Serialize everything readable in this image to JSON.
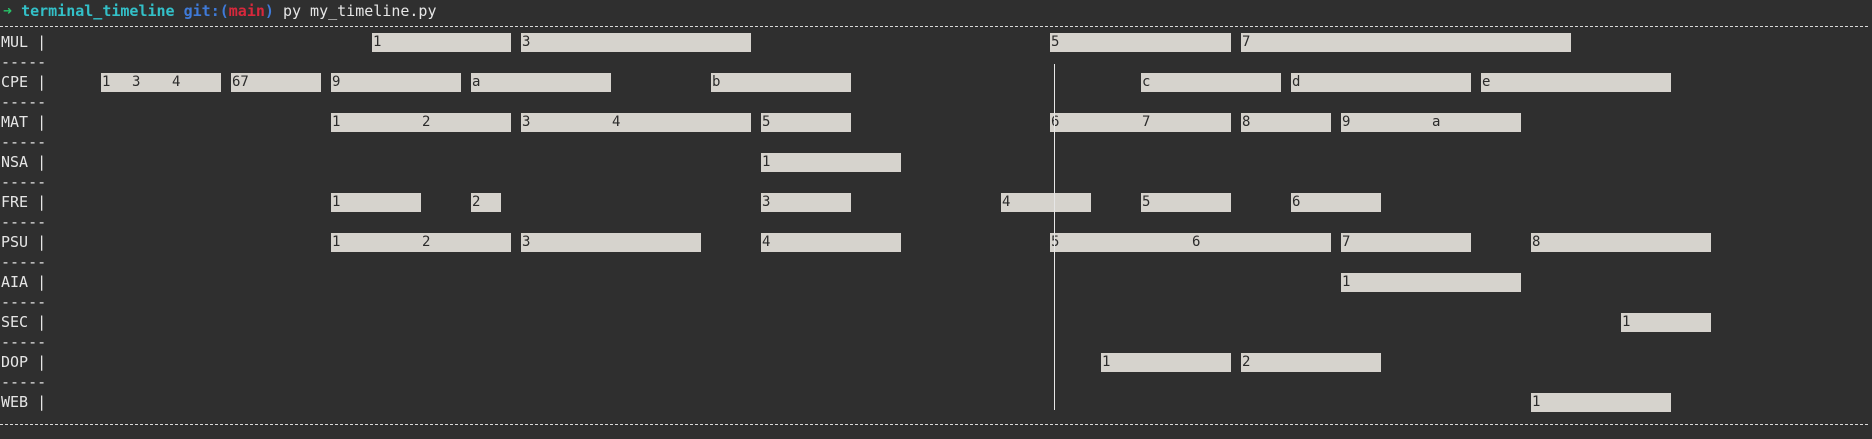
{
  "terminal": {
    "prompt_arrow": "➜",
    "directory": "terminal_timeline",
    "git_prefix": "git:(",
    "git_branch": "main",
    "git_suffix": ")",
    "command": "py my_timeline.py"
  },
  "timeline": {
    "separator": "-----",
    "rows": [
      {
        "label": "MUL |",
        "bars": [
          {
            "start": 372,
            "end": 511,
            "ticks": [
              {
                "text": "1",
                "at": 372
              }
            ]
          },
          {
            "start": 521,
            "end": 751,
            "ticks": [
              {
                "text": "3",
                "at": 521
              }
            ]
          },
          {
            "start": 1050,
            "end": 1231,
            "ticks": [
              {
                "text": "5",
                "at": 1050
              }
            ]
          },
          {
            "start": 1241,
            "end": 1571,
            "ticks": [
              {
                "text": "7",
                "at": 1241
              }
            ]
          }
        ]
      },
      {
        "label": "CPE |",
        "bars": [
          {
            "start": 101,
            "end": 221,
            "ticks": [
              {
                "text": "1",
                "at": 101
              },
              {
                "text": "3",
                "at": 131
              },
              {
                "text": "4",
                "at": 171
              }
            ]
          },
          {
            "start": 231,
            "end": 321,
            "ticks": [
              {
                "text": "67",
                "at": 231
              }
            ]
          },
          {
            "start": 331,
            "end": 461,
            "ticks": [
              {
                "text": "9",
                "at": 331
              }
            ]
          },
          {
            "start": 471,
            "end": 611,
            "ticks": [
              {
                "text": "a",
                "at": 471
              }
            ]
          },
          {
            "start": 711,
            "end": 851,
            "ticks": [
              {
                "text": "b",
                "at": 711
              }
            ]
          },
          {
            "start": 1141,
            "end": 1281,
            "ticks": [
              {
                "text": "c",
                "at": 1141
              }
            ]
          },
          {
            "start": 1291,
            "end": 1471,
            "ticks": [
              {
                "text": "d",
                "at": 1291
              }
            ]
          },
          {
            "start": 1481,
            "end": 1671,
            "ticks": [
              {
                "text": "e",
                "at": 1481
              }
            ]
          }
        ]
      },
      {
        "label": "MAT |",
        "bars": [
          {
            "start": 331,
            "end": 511,
            "ticks": [
              {
                "text": "1",
                "at": 331
              },
              {
                "text": "2",
                "at": 421
              }
            ]
          },
          {
            "start": 521,
            "end": 751,
            "ticks": [
              {
                "text": "3",
                "at": 521
              },
              {
                "text": "4",
                "at": 611
              }
            ]
          },
          {
            "start": 761,
            "end": 851,
            "ticks": [
              {
                "text": "5",
                "at": 761
              }
            ]
          },
          {
            "start": 1050,
            "end": 1231,
            "ticks": [
              {
                "text": "6",
                "at": 1050
              },
              {
                "text": "7",
                "at": 1141
              }
            ]
          },
          {
            "start": 1241,
            "end": 1331,
            "ticks": [
              {
                "text": "8",
                "at": 1241
              }
            ]
          },
          {
            "start": 1341,
            "end": 1521,
            "ticks": [
              {
                "text": "9",
                "at": 1341
              },
              {
                "text": "a",
                "at": 1431
              }
            ]
          }
        ]
      },
      {
        "label": "NSA |",
        "bars": [
          {
            "start": 761,
            "end": 901,
            "ticks": [
              {
                "text": "1",
                "at": 761
              }
            ]
          }
        ]
      },
      {
        "label": "FRE |",
        "bars": [
          {
            "start": 331,
            "end": 421,
            "ticks": [
              {
                "text": "1",
                "at": 331
              }
            ]
          },
          {
            "start": 471,
            "end": 501,
            "ticks": [
              {
                "text": "2",
                "at": 471
              }
            ]
          },
          {
            "start": 761,
            "end": 851,
            "ticks": [
              {
                "text": "3",
                "at": 761
              }
            ]
          },
          {
            "start": 1001,
            "end": 1091,
            "ticks": [
              {
                "text": "4",
                "at": 1001
              }
            ]
          },
          {
            "start": 1141,
            "end": 1231,
            "ticks": [
              {
                "text": "5",
                "at": 1141
              }
            ]
          },
          {
            "start": 1291,
            "end": 1381,
            "ticks": [
              {
                "text": "6",
                "at": 1291
              }
            ]
          }
        ]
      },
      {
        "label": "PSU |",
        "bars": [
          {
            "start": 331,
            "end": 511,
            "ticks": [
              {
                "text": "1",
                "at": 331
              },
              {
                "text": "2",
                "at": 421
              }
            ]
          },
          {
            "start": 521,
            "end": 701,
            "ticks": [
              {
                "text": "3",
                "at": 521
              }
            ]
          },
          {
            "start": 761,
            "end": 901,
            "ticks": [
              {
                "text": "4",
                "at": 761
              }
            ]
          },
          {
            "start": 1050,
            "end": 1331,
            "ticks": [
              {
                "text": "5",
                "at": 1050
              },
              {
                "text": "6",
                "at": 1191
              }
            ]
          },
          {
            "start": 1341,
            "end": 1471,
            "ticks": [
              {
                "text": "7",
                "at": 1341
              }
            ]
          },
          {
            "start": 1531,
            "end": 1711,
            "ticks": [
              {
                "text": "8",
                "at": 1531
              }
            ]
          }
        ]
      },
      {
        "label": "AIA |",
        "bars": [
          {
            "start": 1341,
            "end": 1521,
            "ticks": [
              {
                "text": "1",
                "at": 1341
              }
            ]
          }
        ]
      },
      {
        "label": "SEC |",
        "bars": [
          {
            "start": 1621,
            "end": 1711,
            "ticks": [
              {
                "text": "1",
                "at": 1621
              }
            ]
          }
        ]
      },
      {
        "label": "DOP |",
        "bars": [
          {
            "start": 1101,
            "end": 1231,
            "ticks": [
              {
                "text": "1",
                "at": 1101
              }
            ]
          },
          {
            "start": 1241,
            "end": 1381,
            "ticks": [
              {
                "text": "2",
                "at": 1241
              }
            ]
          }
        ]
      },
      {
        "label": "WEB |",
        "bars": [
          {
            "start": 1531,
            "end": 1671,
            "ticks": [
              {
                "text": "1",
                "at": 1531
              }
            ]
          }
        ]
      }
    ]
  }
}
